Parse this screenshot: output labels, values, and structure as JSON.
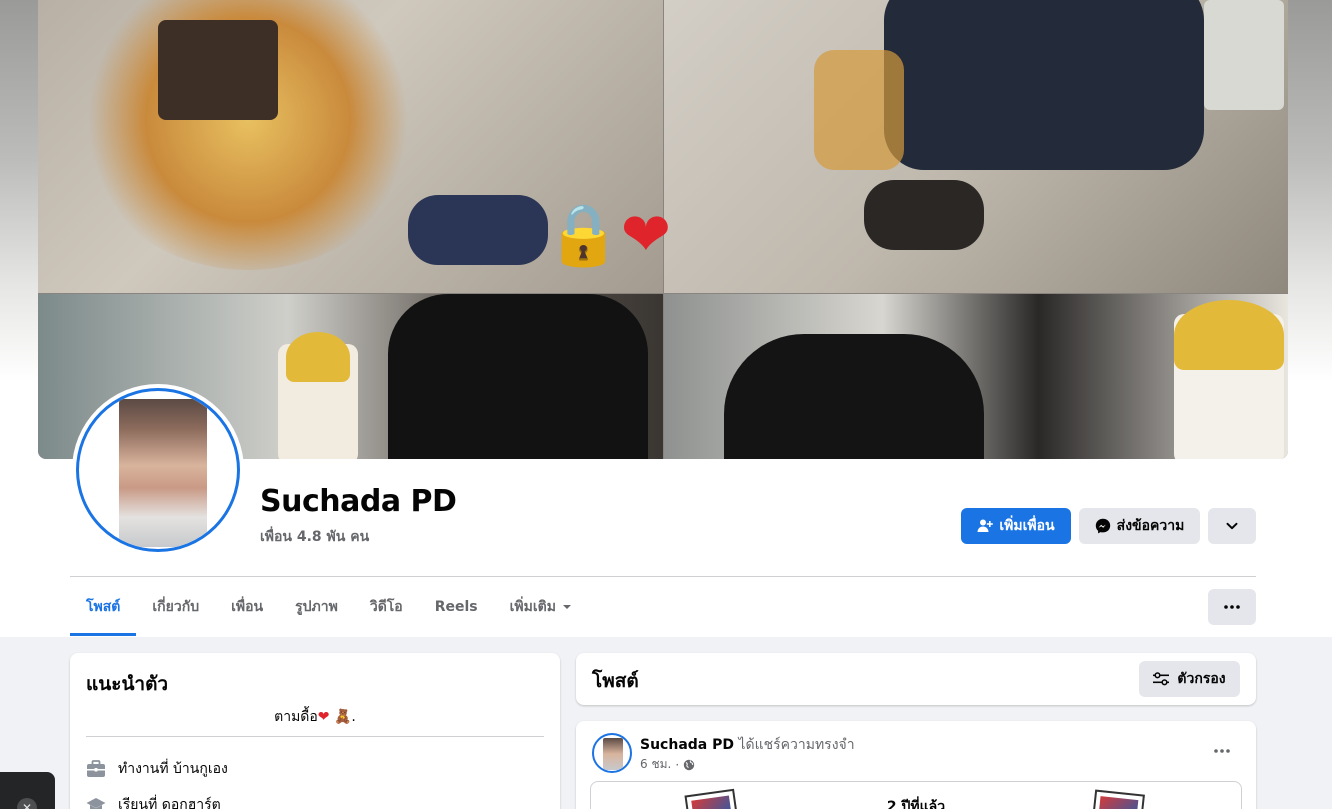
{
  "profile": {
    "name": "Suchada PD",
    "friends_count": "เพื่อน 4.8 พัน คน"
  },
  "actions": {
    "add_friend": "เพิ่มเพื่อน",
    "message": "ส่งข้อความ"
  },
  "tabs": [
    {
      "label": "โพสต์",
      "active": true
    },
    {
      "label": "เกี่ยวกับ",
      "active": false
    },
    {
      "label": "เพื่อน",
      "active": false
    },
    {
      "label": "รูปภาพ",
      "active": false
    },
    {
      "label": "วิดีโอ",
      "active": false
    },
    {
      "label": "Reels",
      "active": false
    },
    {
      "label": "เพิ่มเติม",
      "active": false
    }
  ],
  "cover": {
    "emoji_lock": "🔒",
    "emoji_heart": "❤"
  },
  "intro": {
    "title": "แนะนำตัว",
    "bio_text": "ตามดื้อ",
    "bio_heart": "❤",
    "bio_suffix": "🧸.",
    "work": "ทำงานที่ บ้านกูเอง",
    "education": "เรียนที่ ดอกฮาร์ต"
  },
  "posts": {
    "title": "โพสต์",
    "filter_label": "ตัวกรอง"
  },
  "post": {
    "author": "Suchada PD",
    "action": "ได้แชร์ความทรงจำ",
    "time": "6 ชม.",
    "dot": "·",
    "memory_label": "2 ปีที่แล้ว"
  },
  "colors": {
    "accent": "#1b74e4",
    "secondary_button": "#e4e6eb",
    "page_bg": "#f0f2f5",
    "muted_text": "#65676b"
  },
  "icons": {
    "add_friend": "person-plus-icon",
    "message": "messenger-icon",
    "more": "chevron-down-icon",
    "tab_more": "ellipsis-icon",
    "filter": "sliders-icon",
    "work": "briefcase-icon",
    "education": "graduation-cap-icon",
    "privacy": "globe-icon"
  }
}
